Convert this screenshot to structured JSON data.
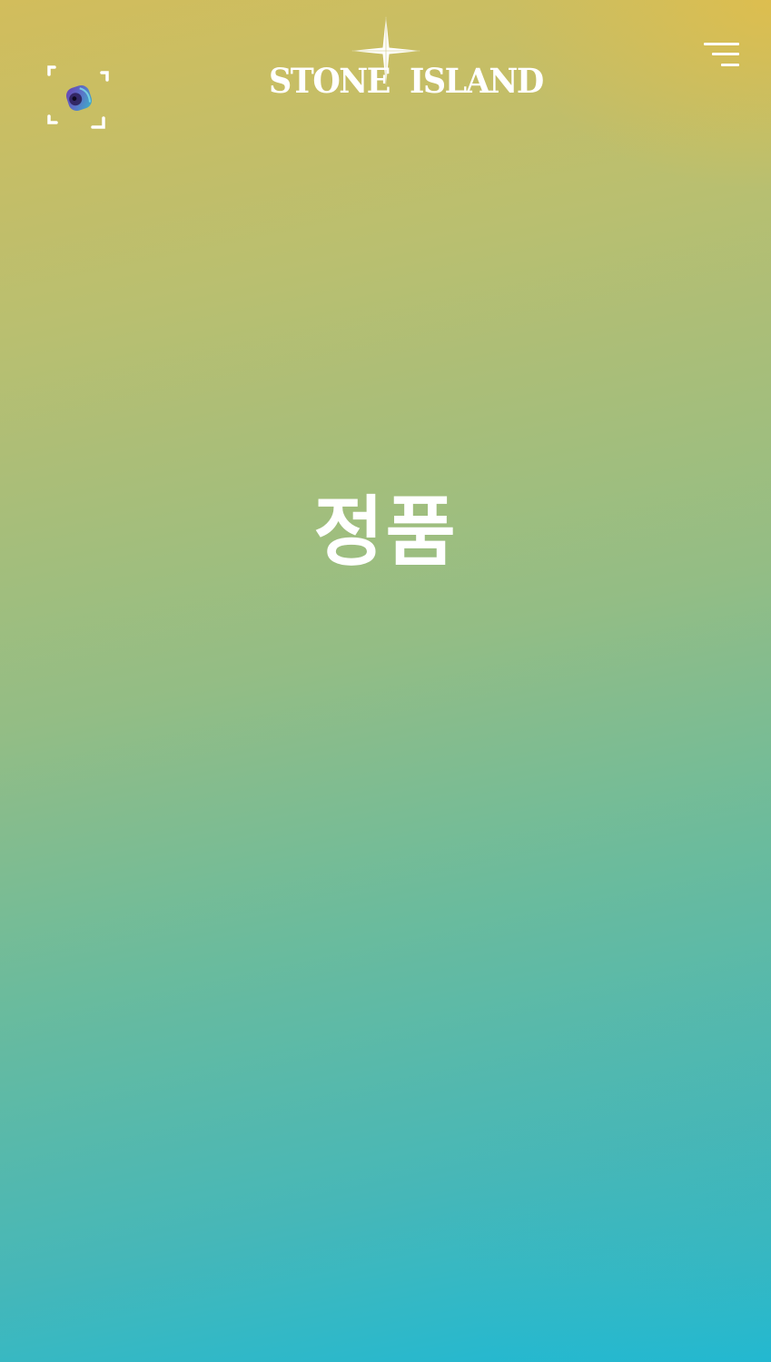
{
  "header": {
    "brand": {
      "word_left": "STONE",
      "word_right": "ISLAND"
    },
    "scan_button": {
      "icon": "camera-scan-icon"
    },
    "menu_button": {
      "icon": "hamburger-menu-icon"
    }
  },
  "hero": {
    "title": "정품"
  },
  "colors": {
    "gradient_top": "#d2bd5c",
    "gradient_bottom": "#1cb9d6",
    "text": "#ffffff",
    "accent_purple": "#6a3fb0",
    "accent_teal": "#3bb5c8"
  }
}
